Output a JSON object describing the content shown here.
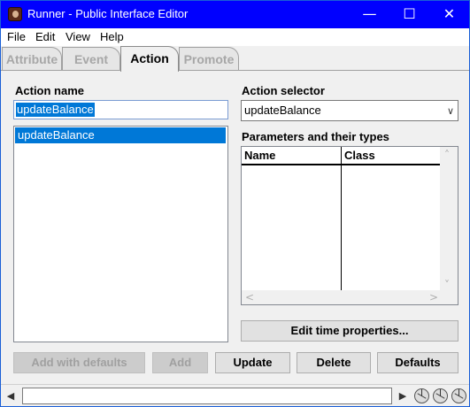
{
  "window": {
    "title": "Runner - Public Interface Editor"
  },
  "menu": {
    "file": "File",
    "edit": "Edit",
    "view": "View",
    "help": "Help"
  },
  "tabs": [
    {
      "label": "Attribute",
      "active": false
    },
    {
      "label": "Event",
      "active": false
    },
    {
      "label": "Action",
      "active": true
    },
    {
      "label": "Promote",
      "active": false
    }
  ],
  "action_name": {
    "label": "Action name",
    "value": "updateBalance",
    "list": [
      "updateBalance"
    ]
  },
  "action_selector": {
    "label": "Action selector",
    "value": "updateBalance"
  },
  "parameters": {
    "label": "Parameters and their types",
    "columns": [
      "Name",
      "Class"
    ]
  },
  "buttons": {
    "edit_time": "Edit time properties...",
    "add_defaults": "Add with defaults",
    "add": "Add",
    "update": "Update",
    "delete": "Delete",
    "defaults": "Defaults"
  },
  "colors": {
    "titlebar": "#0000ff",
    "selection": "#0078d7"
  },
  "icons": [
    "app-icon",
    "minimize-icon",
    "maximize-icon",
    "close-icon",
    "dropdown-arrow-icon",
    "scroll-left-icon",
    "scroll-right-icon",
    "scroll-up-icon",
    "scroll-down-icon"
  ]
}
